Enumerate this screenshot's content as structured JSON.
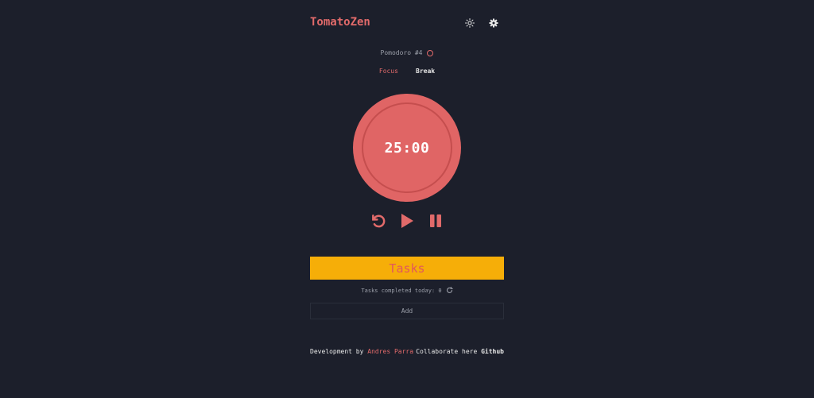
{
  "app": {
    "title": "TomatoZen"
  },
  "header": {
    "theme_icon": "sun-icon",
    "settings_icon": "gear-icon"
  },
  "pomodoro": {
    "label": "Pomodoro #4"
  },
  "modes": {
    "focus": "Focus",
    "break": "Break",
    "active": "focus"
  },
  "timer": {
    "display": "25:00"
  },
  "controls": {
    "reset_icon": "reset-icon",
    "play_icon": "play-icon",
    "pause_icon": "pause-icon"
  },
  "tasks": {
    "title": "Tasks",
    "completed_label": "Tasks completed today: 0",
    "add_label": "Add"
  },
  "footer": {
    "dev_prefix": "Development by",
    "author": "Andres Parra",
    "collab_prefix": "Collaborate here",
    "github_label": "Github"
  },
  "colors": {
    "background": "#1c1f2b",
    "accent": "#e16a6a",
    "tasks_bar": "#f6ae08"
  }
}
